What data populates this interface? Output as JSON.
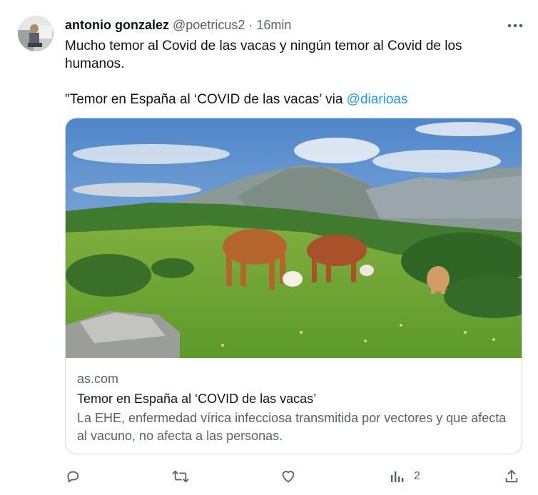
{
  "tweet": {
    "author_name": "antonio gonzalez",
    "handle": "@poetricus2",
    "separator": "·",
    "time": "16min",
    "text_line1": "Mucho temor al Covid de las vacas y ningún temor al Covid de los humanos.",
    "text_line2_prefix": "\"Temor en España al ‘COVID de las vacas’ via ",
    "text_line2_link": "@diarioas"
  },
  "card": {
    "image_alt": "Vacas pastando en un prado de montaña",
    "domain": "as.com",
    "title": "Temor en España al ‘COVID de las vacas’",
    "description": "La EHE, enfermedad vírica infecciosa transmitida por vectores y que afecta al vacuno, no afecta a las personas."
  },
  "actions": {
    "reply_icon": "reply-icon",
    "retweet_icon": "retweet-icon",
    "like_icon": "like-icon",
    "views_icon": "views-icon",
    "views_count": "2",
    "share_icon": "share-icon"
  },
  "colors": {
    "link": "#1d9bf0",
    "secondary_text": "#536471",
    "primary_text": "#0f1419",
    "border": "#cfd9de"
  }
}
